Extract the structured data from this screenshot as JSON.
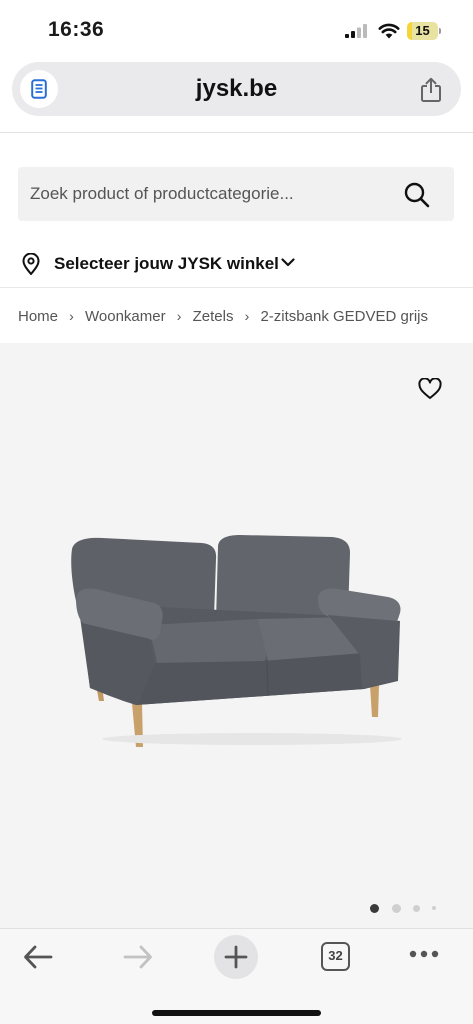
{
  "status_bar": {
    "time": "16:36",
    "battery": "15",
    "battery_level": 0.15
  },
  "browser": {
    "url": "jysk.be",
    "tab_count": "32"
  },
  "search": {
    "placeholder": "Zoek product of productcategorie..."
  },
  "store": {
    "label": "Selecteer jouw JYSK winkel"
  },
  "breadcrumb": [
    "Home",
    "Woonkamer",
    "Zetels",
    "2-zitsbank GEDVED grijs"
  ],
  "gallery": {
    "total_images": 4,
    "active_index": 0
  },
  "colors": {
    "accent": "#111111",
    "sofa": "#5c5f66",
    "background_gallery": "#f4f4f4"
  },
  "icons": [
    "reader-icon",
    "share-icon",
    "search-icon",
    "pin-icon",
    "chevron-down-icon",
    "heart-icon",
    "back-arrow-icon",
    "forward-arrow-icon",
    "plus-icon",
    "tabs-icon",
    "more-icon"
  ]
}
